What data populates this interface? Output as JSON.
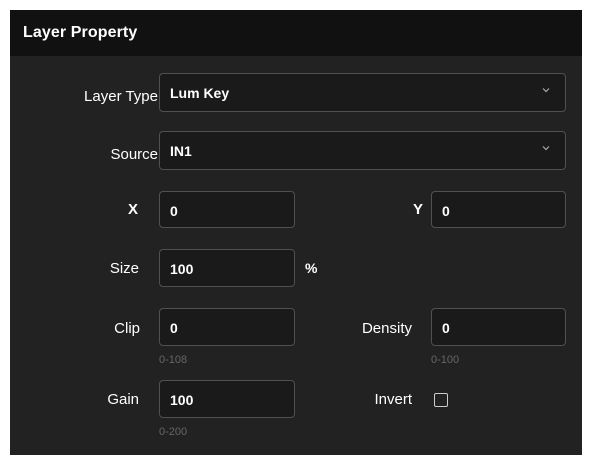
{
  "header": {
    "title": "Layer Property"
  },
  "layer_type": {
    "label": "Layer Type",
    "value": "Lum Key",
    "icon": "chevron-down-icon"
  },
  "source": {
    "label": "Source",
    "value": "IN1",
    "icon": "chevron-down-icon"
  },
  "x": {
    "label": "X",
    "value": "0"
  },
  "y": {
    "label": "Y",
    "value": "0"
  },
  "size": {
    "label": "Size",
    "value": "100",
    "unit": "%"
  },
  "clip": {
    "label": "Clip",
    "value": "0",
    "range": "0-108"
  },
  "density": {
    "label": "Density",
    "value": "0",
    "range": "0-100"
  },
  "gain": {
    "label": "Gain",
    "value": "100",
    "range": "0-200"
  },
  "invert": {
    "label": "Invert",
    "checked": false
  },
  "colors": {
    "background": "#222222",
    "header": "#111111",
    "border": "#505050",
    "hint": "#666666"
  }
}
